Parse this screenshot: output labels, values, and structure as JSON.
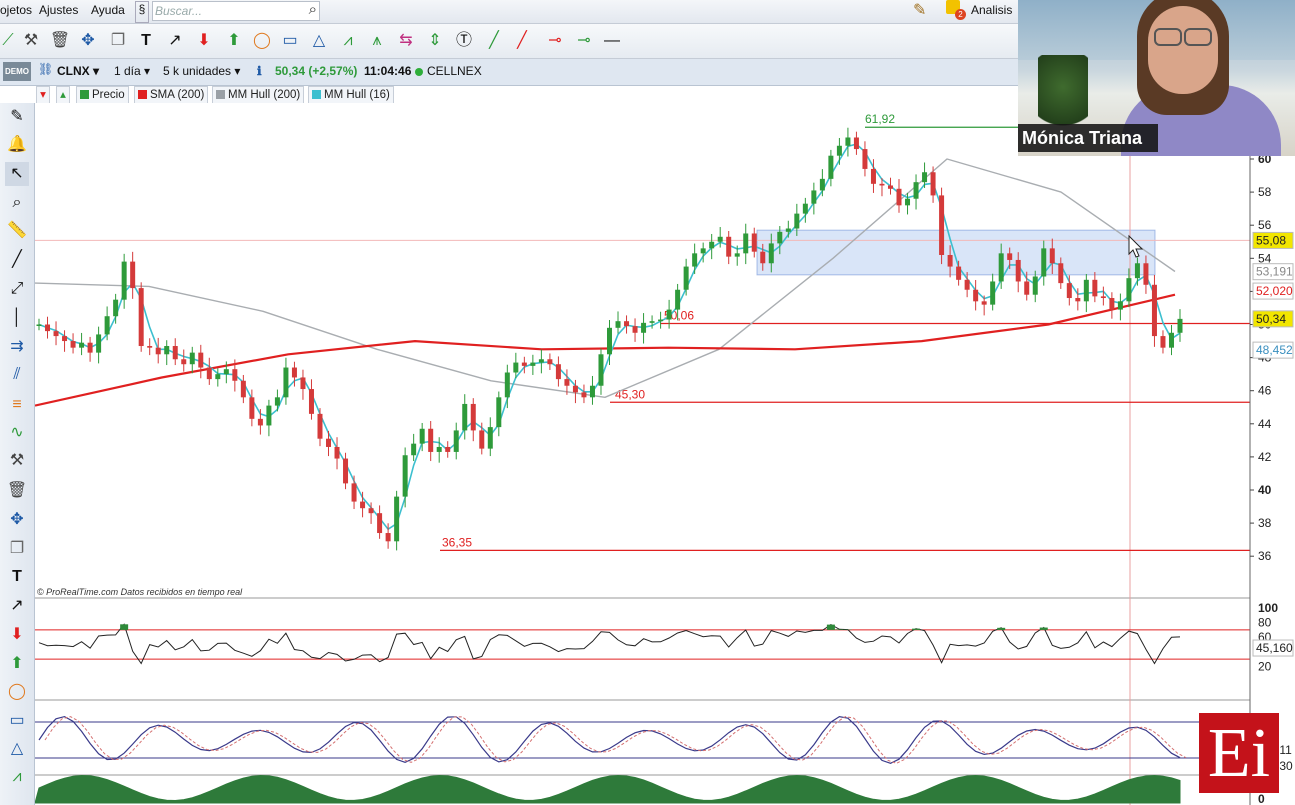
{
  "menu": {
    "items": [
      "ojetos",
      "Ajustes",
      "Ayuda"
    ],
    "search_placeholder": "Buscar...",
    "right_label": "Analisis",
    "notif_count": "2"
  },
  "symbol_bar": {
    "ticker": "CLNX",
    "timeframe": "1 día",
    "units": "5 k unidades",
    "last_quote": "50,34 (+2,57%)",
    "time": "11:04:46",
    "name": "CELLNEX",
    "demo_badge": "DEMO"
  },
  "legend": [
    {
      "label": "Precio",
      "color": "#2e9a3a"
    },
    {
      "label": "SMA (200)",
      "color": "#e02020"
    },
    {
      "label": "MM Hull (200)",
      "color": "#9aa0a6"
    },
    {
      "label": "MM Hull (16)",
      "color": "#3cbfcf"
    }
  ],
  "chart_data": {
    "type": "candlestick",
    "symbol": "CLNX",
    "price_axis_ticks": [
      "60",
      "58",
      "56",
      "54",
      "52",
      "50",
      "48",
      "46",
      "44",
      "42",
      "40",
      "38",
      "36"
    ],
    "price_range": [
      35.3,
      61.2
    ],
    "value_labels": [
      {
        "text": "55,08",
        "value": 55.08,
        "bg": "#f2e600",
        "fg": "#222"
      },
      {
        "text": "53,191",
        "value": 53.191,
        "bg": "#ffffff",
        "fg": "#888"
      },
      {
        "text": "52,020",
        "value": 52.02,
        "bg": "#ffffff",
        "fg": "#e02020"
      },
      {
        "text": "50,34",
        "value": 50.34,
        "bg": "#f2e600",
        "fg": "#222"
      },
      {
        "text": "48,452",
        "value": 48.452,
        "bg": "#ffffff",
        "fg": "#3a8fbf"
      }
    ],
    "annotations": [
      {
        "text": "61,92",
        "value": 61.92,
        "color": "#2e9a3a"
      },
      {
        "text": "50,06",
        "value": 50.06,
        "color": "#e02020"
      },
      {
        "text": "45,30",
        "value": 45.3,
        "color": "#e02020"
      },
      {
        "text": "36,35",
        "value": 36.35,
        "color": "#e02020"
      }
    ],
    "horizontal_levels": [
      61.92,
      50.06,
      45.3,
      36.35
    ],
    "shaded_zone": [
      53.0,
      55.7
    ],
    "close_path": [
      50,
      49.6,
      49.3,
      49,
      48.6,
      48.9,
      48.3,
      49.4,
      50.5,
      51.5,
      53.8,
      52.2,
      48.7,
      48.6,
      48.2,
      48.7,
      47.9,
      47.6,
      48.3,
      47.4,
      46.7,
      47,
      47.3,
      46.6,
      45.6,
      44.3,
      43.9,
      45.1,
      45.6,
      47.4,
      46.8,
      46.1,
      44.6,
      43.1,
      42.6,
      41.9,
      40.4,
      39.3,
      38.9,
      38.6,
      37.4,
      36.9,
      39.6,
      42.1,
      42.8,
      43.7,
      42.3,
      42.6,
      42.3,
      43.6,
      45.2,
      43.6,
      42.5,
      43.8,
      45.6,
      47.1,
      47.7,
      47.5,
      47.7,
      47.9,
      47.6,
      46.7,
      46.3,
      45.9,
      45.6,
      46.3,
      48.2,
      49.8,
      50.2,
      49.9,
      49.5,
      50.1,
      50.2,
      50.3,
      50.9,
      52.1,
      53.5,
      54.3,
      54.6,
      55,
      55.3,
      54.1,
      54.3,
      55.5,
      54.4,
      53.7,
      54.9,
      55.6,
      55.8,
      56.7,
      57.3,
      58.1,
      58.8,
      60.2,
      60.8,
      61.3,
      60.6,
      59.4,
      58.5,
      58.4,
      58.2,
      57.2,
      57.6,
      58.6,
      59.2,
      57.8,
      54.2,
      53.5,
      52.7,
      52.1,
      51.4,
      51.2,
      52.6,
      54.3,
      53.9,
      52.6,
      51.8,
      52.9,
      54.6,
      53.7,
      52.5,
      51.6,
      51.4,
      52.7,
      51.7,
      51.6,
      50.9,
      51.4,
      52.8,
      53.7,
      52.4,
      49.3,
      48.6,
      49.5,
      50.34
    ],
    "sma200": [
      45.1,
      46.8,
      48.2,
      49.0,
      48.5,
      48.6,
      48.5,
      49.0,
      50.0,
      51.8
    ],
    "hull200": [
      52.5,
      52.3,
      50.8,
      48.5,
      46.6,
      45.6,
      48.5,
      54.0,
      60.0,
      58.0,
      53.2
    ],
    "hull16_label": "MM Hull (16)",
    "source_note": "© ProRealTime.com  Datos recibidos en tiempo real",
    "oscillator": {
      "ticks": [
        "100",
        "80",
        "60",
        "40",
        "20"
      ],
      "upper": 70,
      "lower": 30,
      "value_label": "45,160"
    },
    "stochastic": {
      "value_labels": [
        "22,911",
        "31,830"
      ]
    },
    "volume": {
      "tick": "0"
    }
  },
  "video": {
    "presenter": "Mónica Triana"
  },
  "logo": {
    "text": "Ei"
  }
}
